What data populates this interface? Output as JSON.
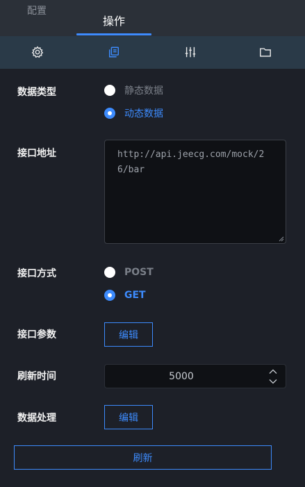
{
  "header": {
    "side_tab_label": "配置",
    "active_tab_label": "操作"
  },
  "iconbar": {
    "icons": [
      "gear-icon",
      "layers-icon",
      "sliders-icon",
      "folder-icon"
    ],
    "active_color": "#3d8bfd"
  },
  "form": {
    "data_type": {
      "label": "数据类型",
      "options": [
        "静态数据",
        "动态数据"
      ],
      "selected": "动态数据"
    },
    "api_url": {
      "label": "接口地址",
      "value": "http://api.jeecg.com/mock/26/bar"
    },
    "method": {
      "label": "接口方式",
      "options": [
        "POST",
        "GET"
      ],
      "selected": "GET"
    },
    "params": {
      "label": "接口参数",
      "button": "编辑"
    },
    "refresh_time": {
      "label": "刷新时间",
      "value": "5000"
    },
    "data_process": {
      "label": "数据处理",
      "button": "编辑"
    },
    "refresh_button": "刷新"
  }
}
